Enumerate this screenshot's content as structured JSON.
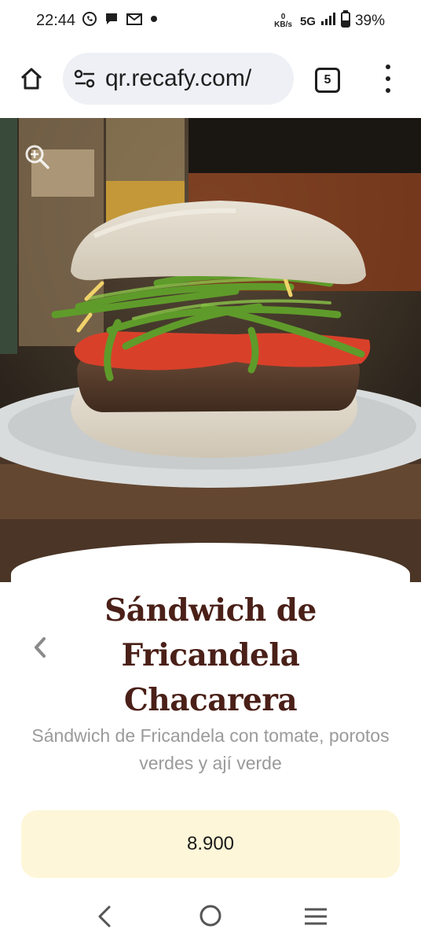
{
  "status_bar": {
    "time": "22:44",
    "speed_value": "0",
    "speed_unit": "KB/s",
    "network": "5G",
    "battery": "39%",
    "icons": [
      "whatsapp-icon",
      "chat-icon",
      "gmail-icon",
      "dot-icon",
      "signal-icon",
      "battery-icon"
    ]
  },
  "browser": {
    "url": "qr.recafy.com/",
    "tab_count": "5",
    "icons": [
      "home-icon",
      "site-settings-icon",
      "more-vert-icon"
    ]
  },
  "product": {
    "title": "Sándwich de Fricandela Chacarera",
    "description": "Sándwich de Fricandela con tomate, porotos verdes y ají verde",
    "price": "8.900"
  },
  "nav": {
    "icons": [
      "back-icon",
      "home-circle-icon",
      "recents-icon"
    ]
  },
  "colors": {
    "title": "#4a2018",
    "price_bg": "#fef6d8",
    "url_bar_bg": "#eef0f5"
  }
}
